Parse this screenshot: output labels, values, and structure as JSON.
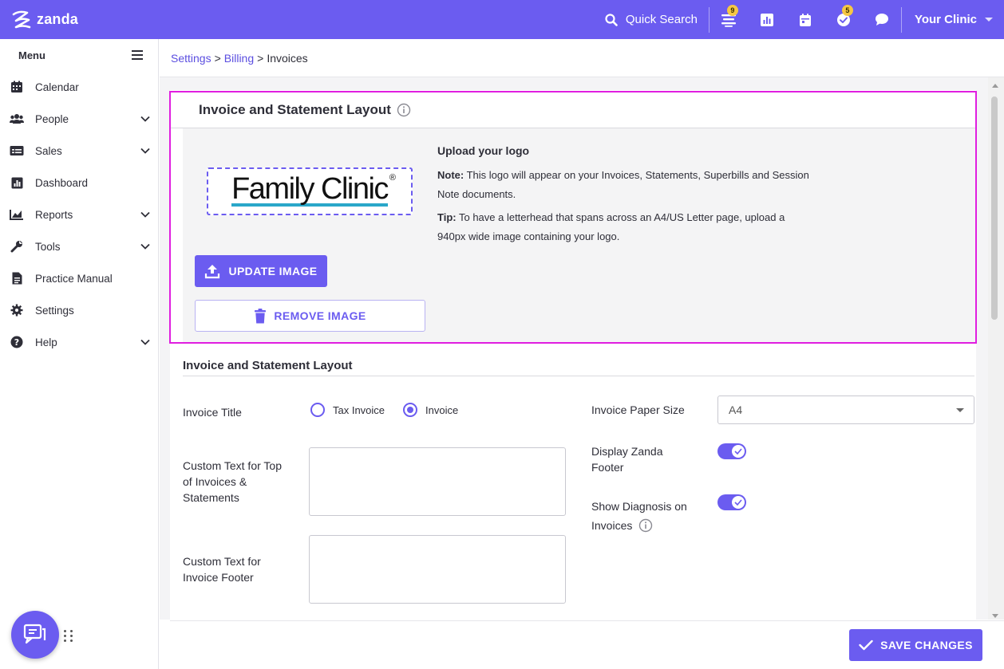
{
  "topbar": {
    "brand": "zanda",
    "quick_search": "Quick Search",
    "icons": [
      "list-icon",
      "chart-icon",
      "calendar-icon",
      "check-circle-icon",
      "chat-bubble-icon"
    ],
    "badge_notifications": "9",
    "badge_tasks": "5",
    "clinic_name": "Your Clinic",
    "accent_color": "#6b5cf0",
    "badge_color": "#f6c744"
  },
  "sidebar": {
    "menu_label": "Menu",
    "items": [
      {
        "label": "Calendar",
        "icon": "calendar-icon",
        "expandable": false
      },
      {
        "label": "People",
        "icon": "people-icon",
        "expandable": true
      },
      {
        "label": "Sales",
        "icon": "sales-icon",
        "expandable": true
      },
      {
        "label": "Dashboard",
        "icon": "dashboard-icon",
        "expandable": false
      },
      {
        "label": "Reports",
        "icon": "reports-icon",
        "expandable": true
      },
      {
        "label": "Tools",
        "icon": "wrench-icon",
        "expandable": true
      },
      {
        "label": "Practice Manual",
        "icon": "document-icon",
        "expandable": false
      },
      {
        "label": "Settings",
        "icon": "gear-icon",
        "expandable": false
      },
      {
        "label": "Help",
        "icon": "help-icon",
        "expandable": true
      }
    ]
  },
  "breadcrumb": {
    "settings": "Settings",
    "billing": "Billing",
    "current": "Invoices",
    "sep": ">"
  },
  "logo_card": {
    "title": "Invoice and Statement Layout",
    "logo_text": "Family Clinic",
    "logo_mark": "®",
    "upload_title": "Upload your logo",
    "note_label": "Note:",
    "note_text": " This logo will appear on your Invoices, Statements, Superbills and Session Note documents.",
    "tip_label": "Tip:",
    "tip_text": " To have a letterhead that spans across an A4/US Letter page, upload a 940px wide image containing your logo.",
    "update_button": "UPDATE IMAGE",
    "remove_button": "REMOVE IMAGE",
    "highlight_color": "#e01ee0"
  },
  "layout_section": {
    "title": "Invoice and Statement Layout",
    "invoice_title_label": "Invoice Title",
    "radio_tax_invoice": "Tax Invoice",
    "radio_invoice": "Invoice",
    "selected_title": "Invoice",
    "custom_top_label": "Custom Text for Top of Invoices & Statements",
    "custom_top_value": "",
    "custom_footer_label": "Custom Text for Invoice Footer",
    "custom_footer_value": "",
    "paper_size_label": "Invoice Paper Size",
    "paper_size_value": "A4",
    "zanda_footer_label": "Display Zanda Footer",
    "zanda_footer_on": true,
    "diagnosis_label": "Show Diagnosis on Invoices",
    "diagnosis_on": true
  },
  "footer": {
    "save_button": "SAVE CHANGES"
  }
}
